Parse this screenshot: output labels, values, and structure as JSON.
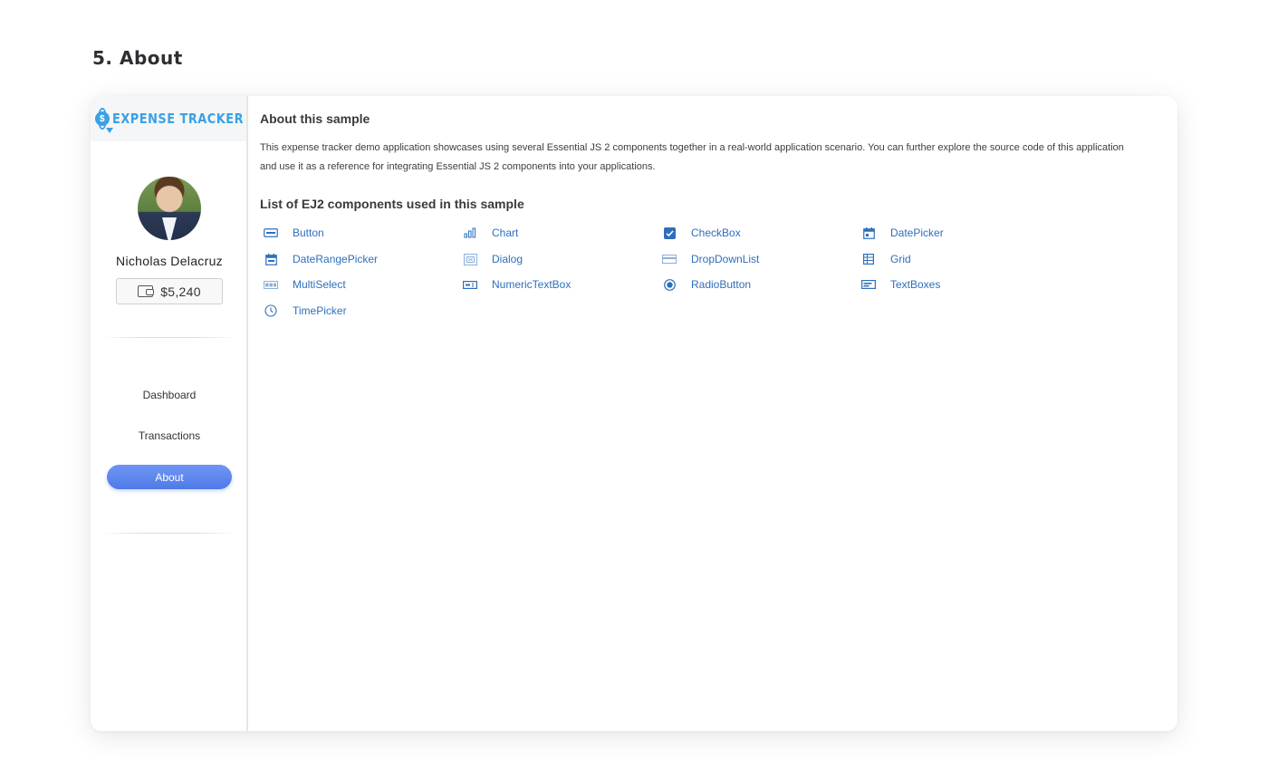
{
  "page": {
    "heading": "5. About"
  },
  "brand": {
    "name": "EXPENSE TRACKER",
    "logo_glyph": "$"
  },
  "user": {
    "name": "Nicholas Delacruz",
    "balance": "$5,240"
  },
  "nav": {
    "items": [
      {
        "label": "Dashboard",
        "active": false
      },
      {
        "label": "Transactions",
        "active": false
      },
      {
        "label": "About",
        "active": true
      }
    ]
  },
  "about": {
    "title": "About this sample",
    "description_line1": "This expense tracker demo application showcases using several Essential JS 2 components together in a real-world application scenario. You can further explore the source code of this application",
    "description_line2": "and use it as a reference for integrating Essential JS 2 components into your applications.",
    "components_title": "List of EJ2 components used in this sample",
    "components": [
      {
        "label": "Button",
        "icon": "button-icon"
      },
      {
        "label": "Chart",
        "icon": "chart-icon"
      },
      {
        "label": "CheckBox",
        "icon": "checkbox-icon"
      },
      {
        "label": "DatePicker",
        "icon": "calendar-icon"
      },
      {
        "label": "DateRangePicker",
        "icon": "calendar-range-icon"
      },
      {
        "label": "Dialog",
        "icon": "dialog-icon"
      },
      {
        "label": "DropDownList",
        "icon": "dropdown-icon"
      },
      {
        "label": "Grid",
        "icon": "grid-icon"
      },
      {
        "label": "MultiSelect",
        "icon": "multiselect-icon"
      },
      {
        "label": "NumericTextBox",
        "icon": "numeric-textbox-icon"
      },
      {
        "label": "RadioButton",
        "icon": "radio-icon"
      },
      {
        "label": "TextBoxes",
        "icon": "textbox-icon"
      },
      {
        "label": "TimePicker",
        "icon": "clock-icon"
      }
    ]
  },
  "colors": {
    "accent": "#4f7be8",
    "brand": "#3aa1e5",
    "link": "#2e6fbd"
  }
}
